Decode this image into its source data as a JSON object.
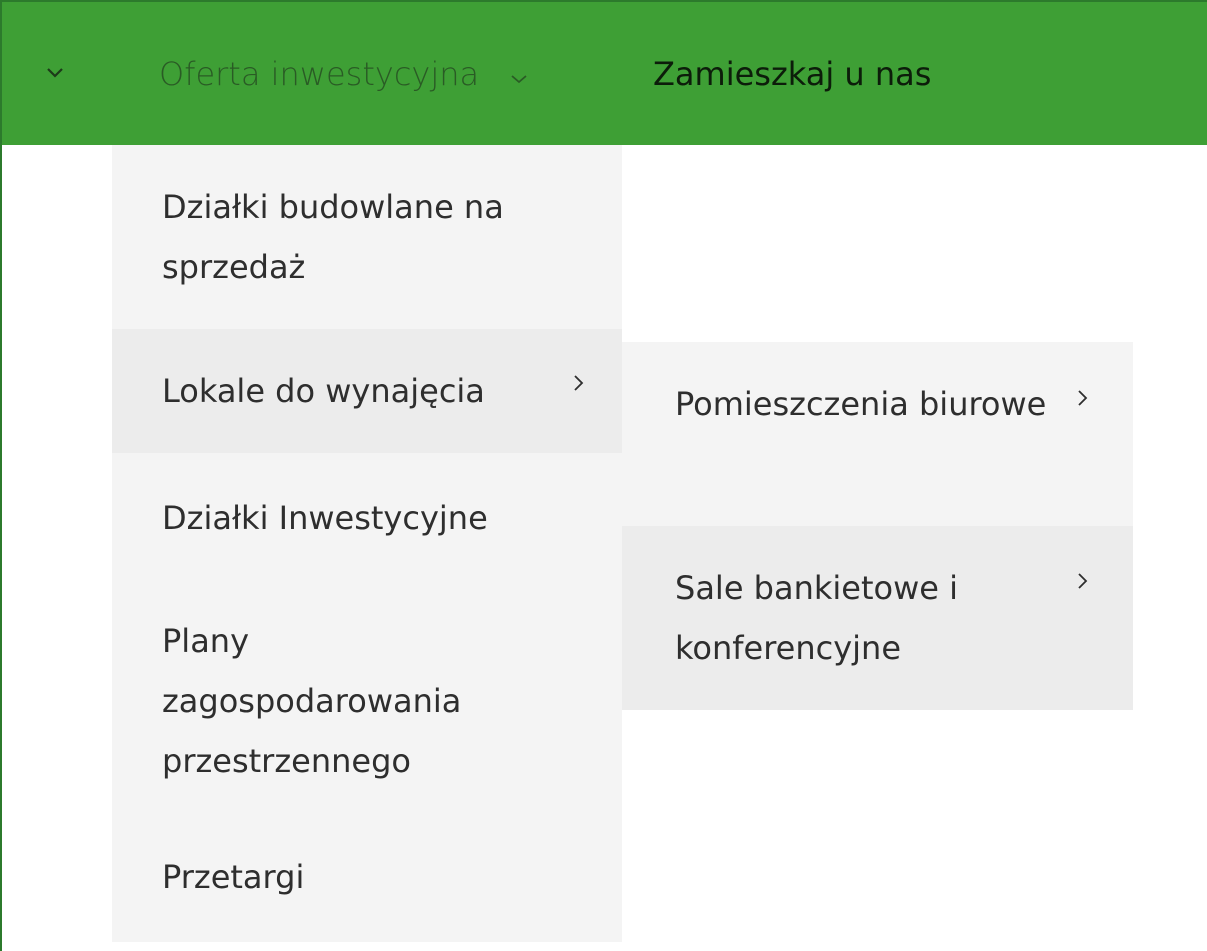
{
  "colors": {
    "navbar_bg": "#3e9f35",
    "menu_bg": "#f4f4f4",
    "menu_active_bg": "#ececec",
    "text": "#2e2e2e"
  },
  "navbar": {
    "toggle_icon": "chevron-down-icon",
    "items": [
      {
        "label": "Oferta inwestycyjna",
        "icon": "chevron-down-icon"
      },
      {
        "label": "Zamieszkaj u nas"
      }
    ]
  },
  "menu": {
    "items": [
      {
        "label": "Działki budowlane na sprzedaż"
      },
      {
        "label": "Lokale do wynajęcia",
        "icon": "chevron-right-icon",
        "active": true
      },
      {
        "label": "Działki Inwestycyjne"
      },
      {
        "label": "Plany zagospodarowania przestrzennego"
      },
      {
        "label": "Przetargi"
      }
    ]
  },
  "submenu": {
    "items": [
      {
        "label": "Pomieszczenia biurowe",
        "icon": "chevron-right-icon"
      },
      {
        "label": "Sale bankietowe i konferencyjne",
        "icon": "chevron-right-icon"
      }
    ]
  }
}
